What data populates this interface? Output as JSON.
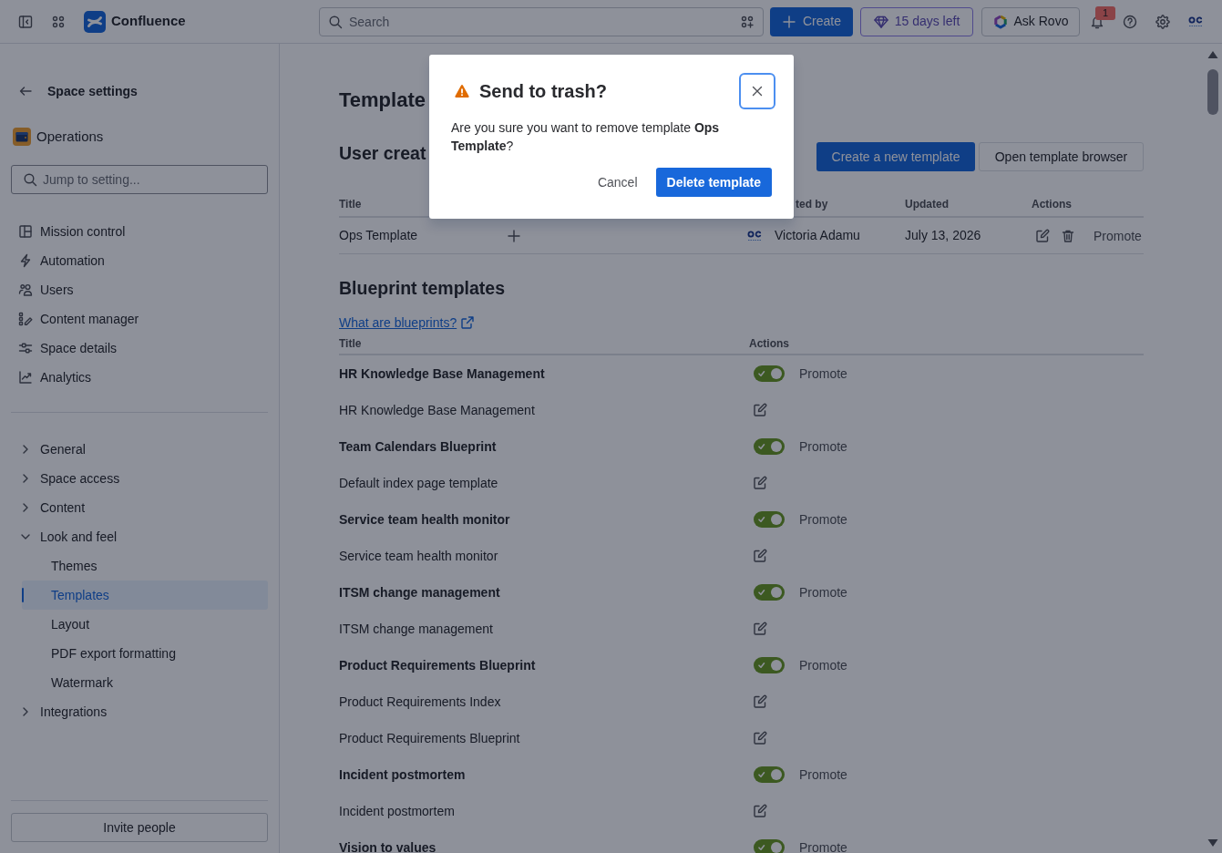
{
  "topbar": {
    "product": "Confluence",
    "search": {
      "placeholder": "Search"
    },
    "buttons": [
      {
        "label": "Create",
        "kind": "create"
      },
      {
        "label": "15 days left",
        "kind": "trial"
      },
      {
        "label": "Ask Rovo",
        "kind": "rovo"
      }
    ],
    "notifications": {
      "count": "1"
    }
  },
  "sidebar": {
    "title": "Space settings",
    "space": "Operations",
    "search": {
      "placeholder": "Jump to setting..."
    },
    "items": [
      {
        "label": "Mission control",
        "selected": false
      },
      {
        "label": "Automation",
        "selected": false
      },
      {
        "label": "Users",
        "selected": false
      },
      {
        "label": "Content manager",
        "selected": false
      },
      {
        "label": "Space details",
        "selected": false
      },
      {
        "label": "Analytics",
        "selected": false
      }
    ],
    "tree": [
      {
        "label": "General",
        "expanded": false,
        "selected": false
      },
      {
        "label": "Space access",
        "expanded": false,
        "selected": false
      },
      {
        "label": "Content",
        "expanded": false,
        "selected": false
      },
      {
        "label": "Look and feel",
        "expanded": true,
        "selected": false,
        "children": [
          {
            "label": "Themes",
            "selected": false
          },
          {
            "label": "Templates",
            "selected": true
          },
          {
            "label": "Layout",
            "selected": false
          },
          {
            "label": "PDF export formatting",
            "selected": false
          },
          {
            "label": "Watermark",
            "selected": false
          }
        ]
      },
      {
        "label": "Integrations",
        "expanded": false,
        "selected": false
      }
    ],
    "invite": "Invite people"
  },
  "main": {
    "heading": "Template",
    "user_templates": {
      "heading": "User creat",
      "buttons": [
        {
          "label": "Create a new template",
          "kind": "primary"
        },
        {
          "label": "Open template browser",
          "kind": "default"
        }
      ],
      "columns": [
        "Title",
        "ted by",
        "Updated",
        "Actions"
      ],
      "rows": [
        {
          "title": "Ops Template",
          "created_by": "Victoria Adamu",
          "updated": "July 13, 2026",
          "action": "Promote"
        }
      ]
    },
    "blueprints": {
      "heading": "Blueprint templates",
      "link": "What are blueprints?",
      "columns": [
        "Title",
        "Actions"
      ],
      "rows": [
        {
          "title": "HR Knowledge Base Management",
          "enabled": true,
          "action": "Promote",
          "templates": [
            {
              "title": "HR Knowledge Base Management"
            }
          ]
        },
        {
          "title": "Team Calendars Blueprint",
          "enabled": true,
          "action": "Promote",
          "templates": [
            {
              "title": "Default index page template"
            }
          ]
        },
        {
          "title": "Service team health monitor",
          "enabled": true,
          "action": "Promote",
          "templates": [
            {
              "title": "Service team health monitor"
            }
          ]
        },
        {
          "title": "ITSM change management",
          "enabled": true,
          "action": "Promote",
          "templates": [
            {
              "title": "ITSM change management"
            }
          ]
        },
        {
          "title": "Product Requirements Blueprint",
          "enabled": true,
          "action": "Promote",
          "templates": [
            {
              "title": "Product Requirements Index"
            },
            {
              "title": "Product Requirements Blueprint"
            }
          ]
        },
        {
          "title": "Incident postmortem",
          "enabled": true,
          "action": "Promote",
          "templates": [
            {
              "title": "Incident postmortem"
            }
          ]
        },
        {
          "title": "Vision to values",
          "enabled": true,
          "action": "Promote"
        }
      ]
    }
  },
  "dialog": {
    "title": "Send to trash?",
    "message": "Are you sure you want to remove template **Ops Template**?",
    "buttons": [
      {
        "label": "Cancel",
        "kind": "subtle"
      },
      {
        "label": "Delete template",
        "kind": "primary"
      }
    ]
  }
}
